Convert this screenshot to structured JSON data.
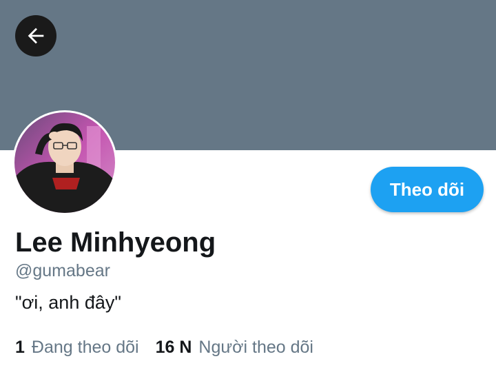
{
  "profile": {
    "name": "Lee Minhyeong",
    "handle": "@gumabear",
    "bio": "\"ơi, anh đây\"",
    "follow_label": "Theo dõi",
    "following_count": "1",
    "following_label": "Đang theo dõi",
    "followers_count": "16 N",
    "followers_label": "Người theo dõi"
  },
  "icons": {
    "back": "back-arrow-icon"
  },
  "colors": {
    "banner": "#657786",
    "accent": "#1da1f2",
    "text_primary": "#14171a",
    "text_secondary": "#657786"
  }
}
